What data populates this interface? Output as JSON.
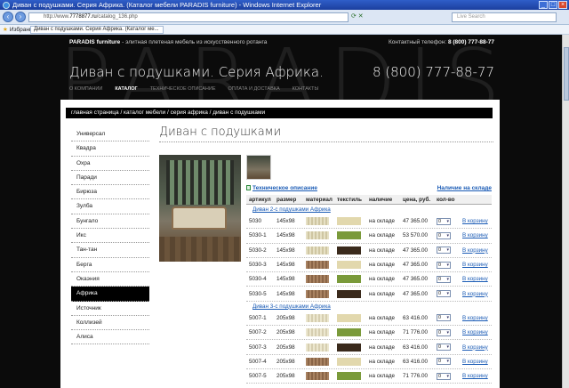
{
  "browser": {
    "title": "Диван с подушками. Серия Африка. (Каталог мебели PARADIS furniture) - Windows Internet Explorer",
    "url_prefix": "http://www.",
    "url_domain": "7778877.ru",
    "url_path": "/catalog_136.php",
    "search_placeholder": "Live Search",
    "favorites_label": "Избранное",
    "tab_title": "Диван с подушками. Серия Африка. (Каталог ме..."
  },
  "site": {
    "watermark": "PARADIS",
    "brand": "PARADIS furniture",
    "tagline": " - элитная плетеная мебель из искусственного ротанга",
    "phone_label": "Контактный телефон: ",
    "phone_small": "8 (800) 777-88-77",
    "page_heading": "Диван с подушками. Серия Африка.",
    "phone_big": "8 (800) 777-88-77",
    "nav": [
      {
        "label": "О КОМПАНИИ",
        "active": false
      },
      {
        "label": "КАТАЛОГ",
        "active": true
      },
      {
        "label": "ТЕХНИЧЕСКОЕ ОПИСАНИЕ",
        "active": false
      },
      {
        "label": "ОПЛАТА И ДОСТАВКА",
        "active": false
      },
      {
        "label": "КОНТАКТЫ",
        "active": false
      }
    ]
  },
  "breadcrumb": "главная страница / каталог мебели / серия африка / диван с подушками",
  "sidebar": [
    {
      "label": "Универсал",
      "active": false
    },
    {
      "label": "Квадра",
      "active": false
    },
    {
      "label": "Охра",
      "active": false
    },
    {
      "label": "Паради",
      "active": false
    },
    {
      "label": "Бирюза",
      "active": false
    },
    {
      "label": "Зулба",
      "active": false
    },
    {
      "label": "Бунгало",
      "active": false
    },
    {
      "label": "Икс",
      "active": false
    },
    {
      "label": "Тан-тан",
      "active": false
    },
    {
      "label": "Берга",
      "active": false
    },
    {
      "label": "Окаэния",
      "active": false
    },
    {
      "label": "Африка",
      "active": true
    },
    {
      "label": "Источник",
      "active": false
    },
    {
      "label": "Коллизей",
      "active": false
    },
    {
      "label": "Алиса",
      "active": false
    }
  ],
  "product": {
    "title": "Диван с подушками",
    "tech_link": "Техническое описание",
    "stock_link": "Наличие на складе"
  },
  "table": {
    "headers": [
      "артикул",
      "размер",
      "материал",
      "текстиль",
      "наличие",
      "цена, руб.",
      "кол-во",
      ""
    ],
    "groups": [
      {
        "name": "Диван 2-с подушками Африка",
        "rows": [
          {
            "sku": "5030",
            "size": "145x98",
            "material": "sw-a",
            "textile": "#e2d8ad",
            "stock": "на складе",
            "price": "47 365.00",
            "qty": "0",
            "action": "В корзину"
          },
          {
            "sku": "5030-1",
            "size": "145x98",
            "material": "sw-a",
            "textile": "#7a9a3a",
            "stock": "на складе",
            "price": "53 570.00",
            "qty": "0",
            "action": "В корзину"
          },
          {
            "sku": "5030-2",
            "size": "145x98",
            "material": "sw-a",
            "textile": "#3a2a1c",
            "stock": "на складе",
            "price": "47 365.00",
            "qty": "0",
            "action": "В корзину"
          },
          {
            "sku": "5030-3",
            "size": "145x98",
            "material": "sw-b",
            "textile": "#e2d8ad",
            "stock": "на складе",
            "price": "47 365.00",
            "qty": "0",
            "action": "В корзину"
          },
          {
            "sku": "5030-4",
            "size": "145x98",
            "material": "sw-b",
            "textile": "#7a9a3a",
            "stock": "на складе",
            "price": "47 365.00",
            "qty": "0",
            "action": "В корзину"
          },
          {
            "sku": "5030-5",
            "size": "145x98",
            "material": "sw-b",
            "textile": "#3a2a1c",
            "stock": "на складе",
            "price": "47 365.00",
            "qty": "0",
            "action": "В корзину"
          }
        ]
      },
      {
        "name": "Диван 3-с подушками Африка",
        "rows": [
          {
            "sku": "5007-1",
            "size": "205x98",
            "material": "sw-c",
            "textile": "#e2d8ad",
            "stock": "на складе",
            "price": "63 416.00",
            "qty": "0",
            "action": "В корзину"
          },
          {
            "sku": "5007-2",
            "size": "205x98",
            "material": "sw-c",
            "textile": "#7a9a3a",
            "stock": "на складе",
            "price": "71 776.00",
            "qty": "0",
            "action": "В корзину"
          },
          {
            "sku": "5007-3",
            "size": "205x98",
            "material": "sw-c",
            "textile": "#3a2a1c",
            "stock": "на складе",
            "price": "63 416.00",
            "qty": "0",
            "action": "В корзину"
          },
          {
            "sku": "5007-4",
            "size": "205x98",
            "material": "sw-b",
            "textile": "#e2d8ad",
            "stock": "на складе",
            "price": "63 416.00",
            "qty": "0",
            "action": "В корзину"
          },
          {
            "sku": "5007-5",
            "size": "205x98",
            "material": "sw-b",
            "textile": "#7a9a3a",
            "stock": "на складе",
            "price": "71 776.00",
            "qty": "0",
            "action": "В корзину"
          }
        ]
      }
    ]
  }
}
